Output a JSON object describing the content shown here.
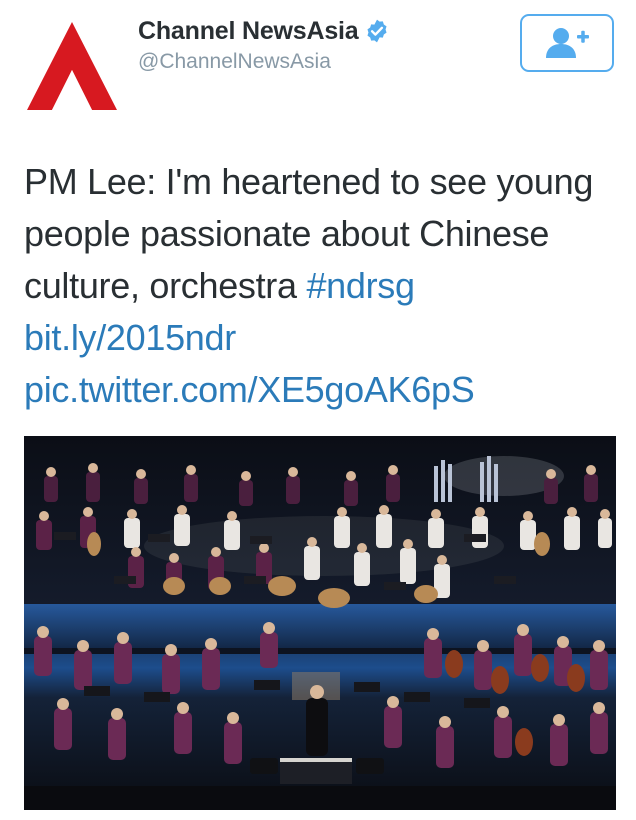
{
  "account": {
    "display_name": "Channel NewsAsia",
    "handle": "@ChannelNewsAsia",
    "verified": true,
    "avatar_icon": "cna-logo-icon",
    "brand_color": "#d71920"
  },
  "follow_button": {
    "icon": "follow-user-plus-icon",
    "accent_color": "#55acee"
  },
  "tweet": {
    "text_plain": "PM Lee: I'm heartened to see young people passionate about Chinese culture, orchestra ",
    "hashtag": "#ndrsg",
    "link_1": "bit.ly/2015ndr",
    "link_2": "pic.twitter.com/XE5goAK6pS",
    "link_color": "#2b7bb9"
  },
  "media": {
    "icon": "orchestra-photo"
  }
}
